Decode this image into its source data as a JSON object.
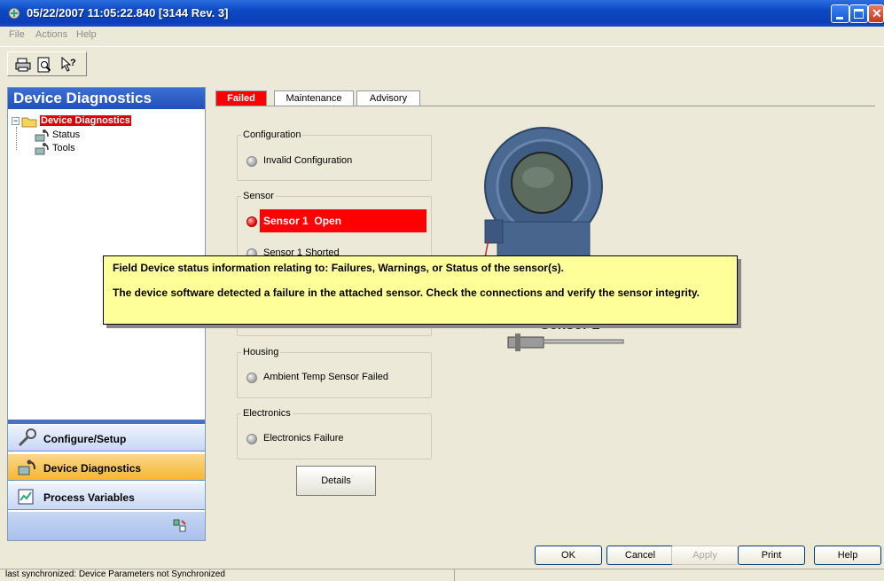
{
  "window": {
    "title": "05/22/2007 11:05:22.840 [3144 Rev. 3]"
  },
  "menu": [
    "File",
    "Actions",
    "Help"
  ],
  "toolbar": {
    "icons": [
      "print-icon",
      "print-preview-icon",
      "context-help-icon"
    ]
  },
  "left_panel": {
    "header": "Device Diagnostics",
    "tree": {
      "root": "Device Diagnostics",
      "children": [
        "Status",
        "Tools"
      ]
    },
    "nav": [
      "Configure/Setup",
      "Device Diagnostics",
      "Process Variables"
    ]
  },
  "tabs": [
    "Failed",
    "Maintenance",
    "Advisory"
  ],
  "groups": {
    "configuration": {
      "title": "Configuration",
      "items": [
        "Invalid Configuration"
      ]
    },
    "sensor": {
      "title": "Sensor",
      "items": [
        "Sensor 1  Open",
        "Sensor 1 Shorted"
      ]
    },
    "housing": {
      "title": "Housing",
      "items": [
        "Ambient Temp Sensor Failed"
      ]
    },
    "electronics": {
      "title": "Electronics",
      "items": [
        "Electronics Failure"
      ]
    }
  },
  "details_button": "Details",
  "image_label": "Sensor 2",
  "tooltip": {
    "line1": "Field Device status information relating to: Failures, Warnings, or Status of the sensor(s).",
    "line2": "The device software detected a failure in the attached sensor. Check the connections and verify the sensor integrity."
  },
  "buttons": {
    "ok": "OK",
    "cancel": "Cancel",
    "apply": "Apply",
    "print": "Print",
    "help": "Help"
  },
  "status_bar": "last synchronized: Device Parameters not Synchronized",
  "colors": {
    "accent": "#2150b8",
    "failed": "#ff0000",
    "nav_active": "#f5b731",
    "tooltip_bg": "#ffff99"
  }
}
